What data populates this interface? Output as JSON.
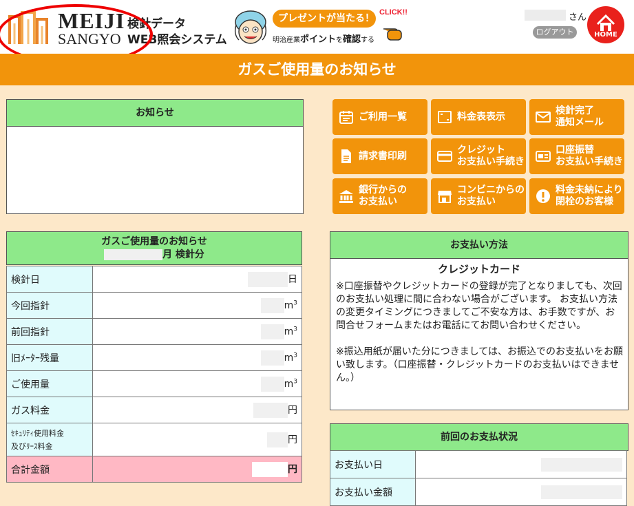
{
  "header": {
    "brand_line1": "MEIJI",
    "brand_line2": "SANGYO",
    "system_line1": "検針データ",
    "system_line2": "WEB照会システム",
    "promo_badge": "プレゼントが当たる！",
    "promo_click": "CLICK!!",
    "promo_company": "明治産業",
    "promo_point": "ポイント",
    "promo_wo": "を",
    "promo_check": "確認",
    "promo_suru": "する",
    "user_suffix": "さん",
    "logout_label": "ログアウト",
    "home_label": "HOME"
  },
  "page_title": "ガスご使用量のお知らせ",
  "notice": {
    "heading": "お知らせ"
  },
  "menu": [
    {
      "label1": "ご利用一覧",
      "label2": "",
      "icon": "calendar-icon"
    },
    {
      "label1": "料金表表示",
      "label2": "",
      "icon": "fullscreen-icon"
    },
    {
      "label1": "検針完了",
      "label2": "通知メール",
      "icon": "mail-icon"
    },
    {
      "label1": "請求書印刷",
      "label2": "",
      "icon": "document-icon"
    },
    {
      "label1": "クレジット",
      "label2": "お支払い手続き",
      "icon": "credit-card-icon"
    },
    {
      "label1": "口座振替",
      "label2": "お支払い手続き",
      "icon": "bank-card-icon"
    },
    {
      "label1": "銀行からの",
      "label2": "お支払い",
      "icon": "bank-icon"
    },
    {
      "label1": "コンビニからの",
      "label2": "お支払い",
      "icon": "store-icon"
    },
    {
      "label1": "料金未納により",
      "label2": "閉栓のお客様",
      "icon": "alert-icon"
    }
  ],
  "usage": {
    "heading": "ガスご使用量のお知らせ",
    "subheading": "月 検針分",
    "rows": [
      {
        "label": "検針日",
        "unit": "日"
      },
      {
        "label": "今回指針",
        "unit": "m",
        "sup": "3"
      },
      {
        "label": "前回指針",
        "unit": "m",
        "sup": "3"
      },
      {
        "label": "旧ﾒｰﾀｰ残量",
        "unit": "m",
        "sup": "3"
      },
      {
        "label": "ご使用量",
        "unit": "m",
        "sup": "3"
      },
      {
        "label": "ガス料金",
        "unit": "円"
      },
      {
        "label1": "ｾｷｭﾘﾃｨ使用料金",
        "label2": "及びﾘｰｽ料金",
        "unit": "円"
      },
      {
        "label": "合計金額",
        "unit": "円"
      }
    ]
  },
  "payment_method": {
    "heading": "お支払い方法",
    "method": "クレジットカード",
    "note1": "※口座振替やクレジットカードの登録が完了となりましても、次回のお支払い処理に間に合わない場合がございます。 お支払い方法の変更タイミングにつきましてご不安な方は、お手数ですが、お問合せフォームまたはお電話にてお問い合わせください。",
    "note2": "※振込用紙が届いた分につきましては、お振込でのお支払いをお願い致します。（口座振替・クレジットカードのお支払いはできません。）"
  },
  "previous_payment": {
    "heading": "前回のお支払状況",
    "rows": [
      {
        "label": "お支払い日"
      },
      {
        "label": "お支払い金額"
      }
    ]
  },
  "colors": {
    "accent": "#f2940b",
    "header_green": "#8ee98a",
    "key_cell": "#e0fbfc",
    "total_row": "#ffb8c4",
    "background": "#fde8c9"
  }
}
